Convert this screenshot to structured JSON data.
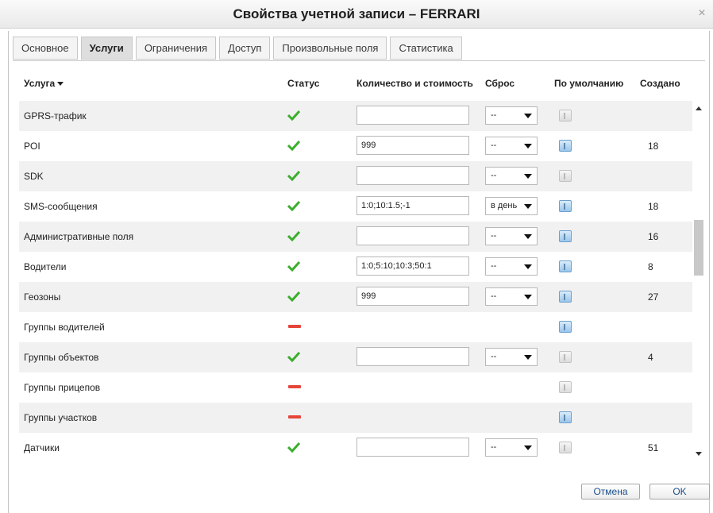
{
  "window": {
    "title": "Свойства учетной записи – FERRARI",
    "close_label": "×"
  },
  "tabs": [
    {
      "label": "Основное",
      "active": false
    },
    {
      "label": "Услуги",
      "active": true
    },
    {
      "label": "Ограничения",
      "active": false
    },
    {
      "label": "Доступ",
      "active": false
    },
    {
      "label": "Произвольные поля",
      "active": false
    },
    {
      "label": "Статистика",
      "active": false
    }
  ],
  "table": {
    "headers": {
      "service": "Услуга",
      "status": "Статус",
      "quantity": "Количество и стоимость",
      "reset": "Сброс",
      "default": "По умолчанию",
      "created": "Создано"
    },
    "rows": [
      {
        "name": "GPRS-трафик",
        "status": "enabled",
        "qty": "",
        "reset": "--",
        "default": false,
        "created": ""
      },
      {
        "name": "POI",
        "status": "enabled",
        "qty": "999",
        "reset": "--",
        "default": true,
        "created": "18"
      },
      {
        "name": "SDK",
        "status": "enabled",
        "qty": "",
        "reset": "--",
        "default": false,
        "created": ""
      },
      {
        "name": "SMS-сообщения",
        "status": "enabled",
        "qty": "1:0;10:1.5;-1",
        "reset": "в день",
        "default": true,
        "created": "18"
      },
      {
        "name": "Административные поля",
        "status": "enabled",
        "qty": "",
        "reset": "--",
        "default": true,
        "created": "16"
      },
      {
        "name": "Водители",
        "status": "enabled",
        "qty": "1:0;5:10;10:3;50:1",
        "reset": "--",
        "default": true,
        "created": "8"
      },
      {
        "name": "Геозоны",
        "status": "enabled",
        "qty": "999",
        "reset": "--",
        "default": true,
        "created": "27"
      },
      {
        "name": "Группы водителей",
        "status": "disabled",
        "qty": null,
        "reset": null,
        "default": true,
        "created": ""
      },
      {
        "name": "Группы объектов",
        "status": "enabled",
        "qty": "",
        "reset": "--",
        "default": false,
        "created": "4"
      },
      {
        "name": "Группы прицепов",
        "status": "disabled",
        "qty": null,
        "reset": null,
        "default": false,
        "created": ""
      },
      {
        "name": "Группы участков",
        "status": "disabled",
        "qty": null,
        "reset": null,
        "default": true,
        "created": ""
      },
      {
        "name": "Датчики",
        "status": "enabled",
        "qty": "",
        "reset": "--",
        "default": false,
        "created": "51"
      }
    ]
  },
  "buttons": {
    "cancel": "Отмена",
    "ok": "OK"
  },
  "colors": {
    "check": "#3cae2e",
    "dash": "#e6453a",
    "link": "#1a4f8a"
  },
  "icons": {
    "enabled": "check-icon",
    "disabled": "dash-icon",
    "default": "info-icon"
  }
}
